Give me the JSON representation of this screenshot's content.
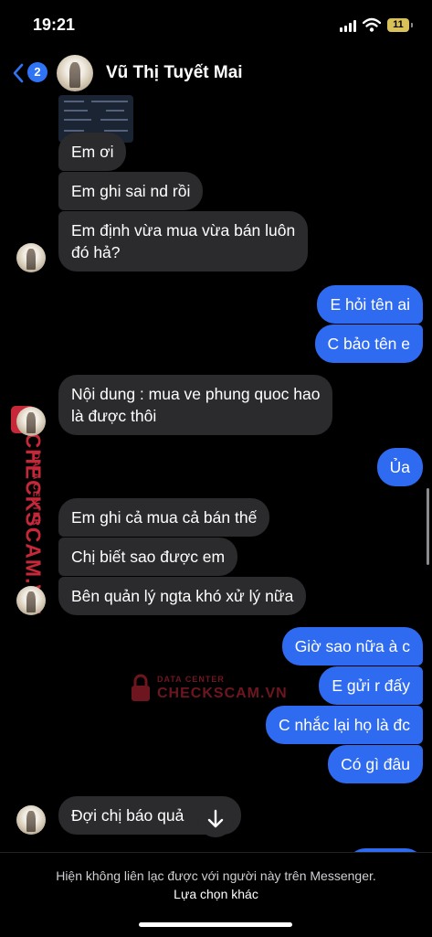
{
  "status_bar": {
    "time": "19:21",
    "battery": "11"
  },
  "header": {
    "back_badge": "2",
    "contact_name": "Vũ Thị Tuyết Mai"
  },
  "messages": [
    {
      "text": "Em ơi"
    },
    {
      "text": "Em ghi sai nd rồi"
    },
    {
      "line1": "Em định vừa mua vừa bán luôn",
      "line2": "đó hả?"
    },
    {
      "text": "E hỏi tên ai"
    },
    {
      "text": "C bảo tên e"
    },
    {
      "line1": "Nội dung : mua ve phung quoc hao",
      "line2": "là được thôi"
    },
    {
      "text": "Ủa"
    },
    {
      "text": "Em ghi cả mua cả bán thế"
    },
    {
      "text": "Chị biết sao được em"
    },
    {
      "text": "Bên quản lý ngta khó xử lý nữa"
    },
    {
      "text": "Giờ sao nữa à c"
    },
    {
      "text": "E gửi r đấy"
    },
    {
      "text": "C nhắc lại họ là đc"
    },
    {
      "text": "Có gì đâu"
    },
    {
      "text": "Đợi chị báo quả      hé"
    }
  ],
  "watermark": {
    "brand": "CHECKSCAM.VN",
    "tagline": "DATA CENTER"
  },
  "footer": {
    "notice": "Hiện không liên lạc được với người này trên Messenger.",
    "action": "Lựa chọn khác"
  },
  "colors": {
    "outgoing": "#2f6bf0",
    "incoming": "#2b2b2e",
    "watermark": "#c6283a"
  },
  "icons": [
    "back-chevron-icon",
    "signal-icon",
    "wifi-icon",
    "battery-icon",
    "arrow-down-icon",
    "lock-icon"
  ]
}
